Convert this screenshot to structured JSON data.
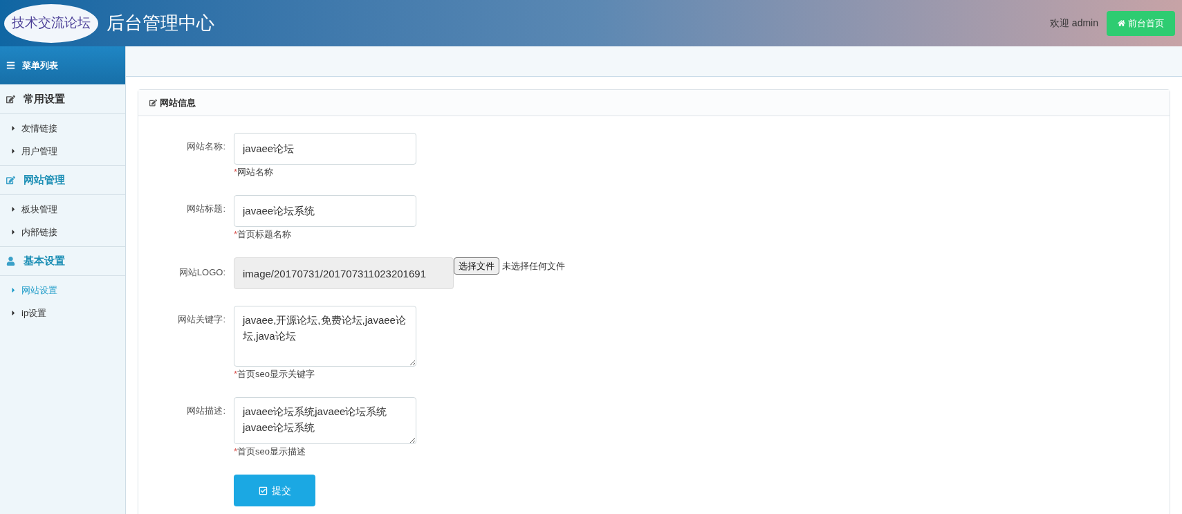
{
  "header": {
    "logo": "技术交流论坛",
    "title": "后台管理中心",
    "welcome": "欢迎 admin",
    "home_button": "前台首页"
  },
  "sidebar": {
    "title": "菜单列表",
    "groups": [
      {
        "title": "常用设置",
        "kind": "edit",
        "selected": false,
        "items": [
          {
            "label": "友情链接",
            "selected": false
          },
          {
            "label": "用户管理",
            "selected": false
          }
        ]
      },
      {
        "title": "网站管理",
        "kind": "edit",
        "selected": true,
        "items": [
          {
            "label": "板块管理",
            "selected": false
          },
          {
            "label": "内部链接",
            "selected": false
          }
        ]
      },
      {
        "title": "基本设置",
        "kind": "user",
        "selected": true,
        "items": [
          {
            "label": "网站设置",
            "selected": true
          },
          {
            "label": "ip设置",
            "selected": false
          }
        ]
      }
    ]
  },
  "panel": {
    "title": "网站信息",
    "fields": [
      {
        "kind": "text",
        "label": "网站名称:",
        "value": "javaee论坛",
        "required_mark": "*",
        "hint": "网站名称"
      },
      {
        "kind": "text",
        "label": "网站标题:",
        "value": "javaee论坛系统",
        "required_mark": "*",
        "hint": "首页标题名称"
      },
      {
        "kind": "file",
        "label": "网站LOGO:",
        "value": "image/20170731/201707311023201691",
        "button": "选择文件",
        "status": "未选择任何文件"
      },
      {
        "kind": "textarea",
        "label": "网站关键字:",
        "value": "javaee,开源论坛,免费论坛,javaee论坛,java论坛",
        "required_mark": "*",
        "hint": "首页seo显示关键字"
      },
      {
        "kind": "textarea",
        "label": "网站描述:",
        "value": "javaee论坛系统javaee论坛系统javaee论坛系统",
        "required_mark": "*",
        "hint": "首页seo显示描述"
      }
    ],
    "submit": "提交"
  }
}
